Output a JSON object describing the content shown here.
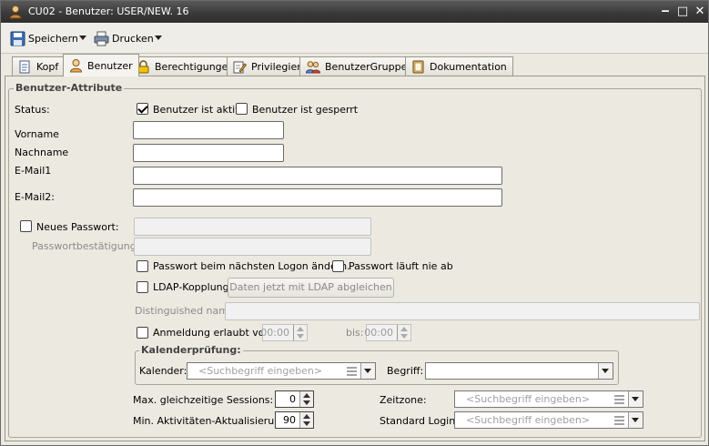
{
  "window": {
    "title": "CU02 - Benutzer: USER/NEW. 16",
    "minimize": "‒",
    "maximize": "□",
    "close": "✕"
  },
  "toolbar": {
    "save_label": "Speichern",
    "print_label": "Drucken"
  },
  "tabs": [
    {
      "label": "Kopf"
    },
    {
      "label": "Benutzer"
    },
    {
      "label": "Berechtigungen"
    },
    {
      "label": "Privilegien"
    },
    {
      "label": "BenutzerGruppen"
    },
    {
      "label": "Dokumentation"
    }
  ],
  "form": {
    "group_title": "Benutzer-Attribute",
    "status_label": "Status:",
    "active_label": "Benutzer ist aktiv",
    "locked_label": "Benutzer ist gesperrt",
    "vorname_label": "Vorname",
    "nachname_label": "Nachname",
    "email1_label": "E-Mail1",
    "email2_label": "E-Mail2:",
    "new_password_label": "Neues Passwort:",
    "password_confirm_label": "Passwortbestätigung:",
    "change_on_logon_label": "Passwort beim nächsten Logon ändern.",
    "never_expires_label": "Passwort läuft nie ab",
    "ldap_label": "LDAP-Kopplung",
    "ldap_sync_button": "Daten jetzt mit LDAP abgleichen",
    "distinguished_label": "Distinguished name:",
    "login_allowed_label": "Anmeldung erlaubt von:",
    "from_time": "00:00",
    "until_label": "bis:",
    "until_time": "00:00",
    "calendar_group_title": "Kalenderprüfung:",
    "calendar_label": "Kalender:",
    "calendar_placeholder": "<Suchbegriff eingeben>",
    "term_label": "Begriff:",
    "max_sessions_label": "Max. gleichzeitige Sessions:",
    "max_sessions_value": "0",
    "min_activity_label": "Min. Aktivitäten-Aktualisierung:",
    "min_activity_value": "90",
    "timezone_label": "Zeitzone:",
    "timezone_placeholder": "<Suchbegriff eingeben>",
    "standard_login_label": "Standard Login:",
    "standard_login_placeholder": "<Suchbegriff eingeben>"
  }
}
